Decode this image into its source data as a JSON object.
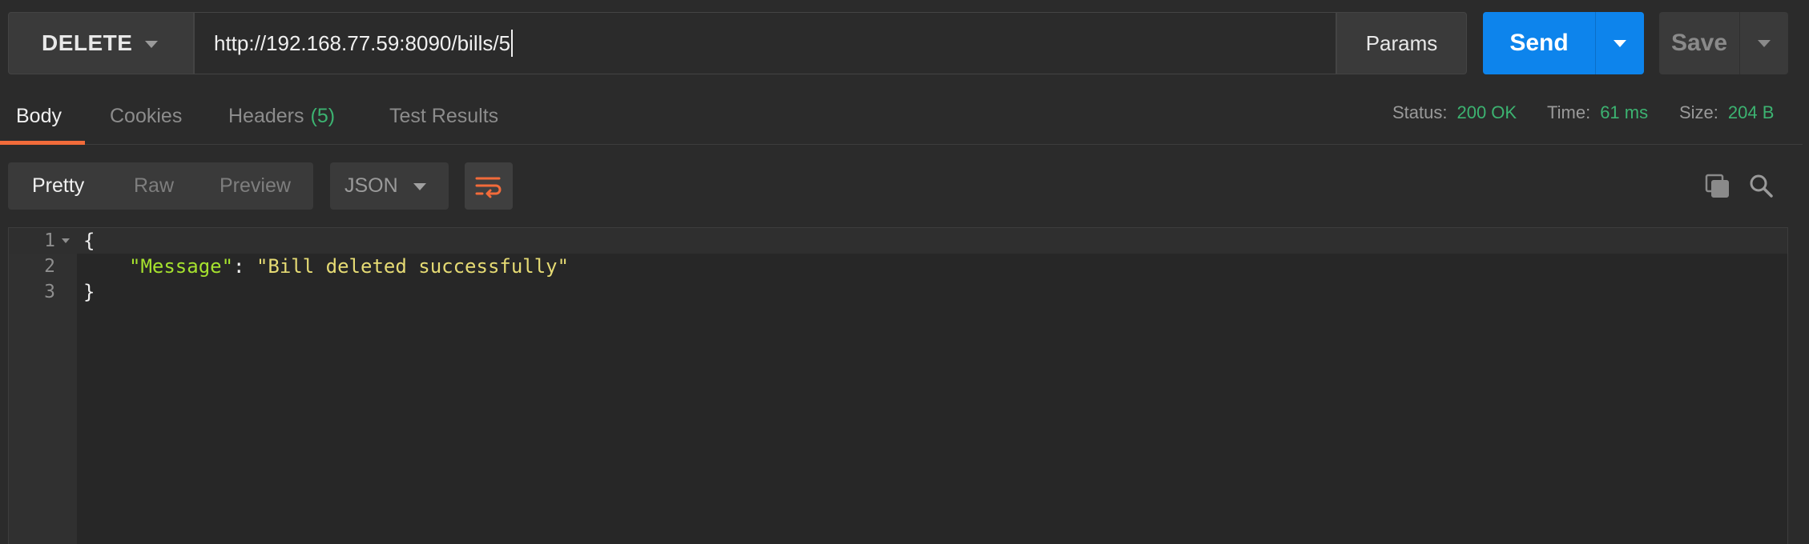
{
  "request": {
    "method": "DELETE",
    "url": "http://192.168.77.59:8090/bills/5",
    "params_label": "Params",
    "send_label": "Send",
    "save_label": "Save"
  },
  "response_tabs": [
    {
      "label": "Body",
      "active": true
    },
    {
      "label": "Cookies",
      "active": false
    },
    {
      "label": "Headers",
      "count": "(5)",
      "active": false
    },
    {
      "label": "Test Results",
      "active": false
    }
  ],
  "status": {
    "status_label": "Status:",
    "status_value": "200 OK",
    "time_label": "Time:",
    "time_value": "61 ms",
    "size_label": "Size:",
    "size_value": "204 B"
  },
  "view_options": [
    {
      "label": "Pretty",
      "active": true
    },
    {
      "label": "Raw",
      "active": false
    },
    {
      "label": "Preview",
      "active": false
    }
  ],
  "format": "JSON",
  "icons": {
    "method_caret": "chevron-down-icon",
    "send_caret": "chevron-down-icon",
    "save_caret": "chevron-down-icon",
    "wrap": "wrap-lines-icon",
    "copy": "copy-icon",
    "search": "search-icon"
  },
  "colors": {
    "send": "#0d84ec",
    "active_tab_underline": "#f26b3a",
    "status_value": "#3cb371",
    "json_key": "#a6e22e",
    "json_string": "#e6db74",
    "wrap_icon": "#f26b3a"
  },
  "editor": {
    "line_numbers": [
      "1",
      "2",
      "3"
    ],
    "lines": {
      "open_brace": "{",
      "key": "\"Message\"",
      "colon": ": ",
      "value": "\"Bill deleted successfully\"",
      "close_brace": "}"
    }
  }
}
